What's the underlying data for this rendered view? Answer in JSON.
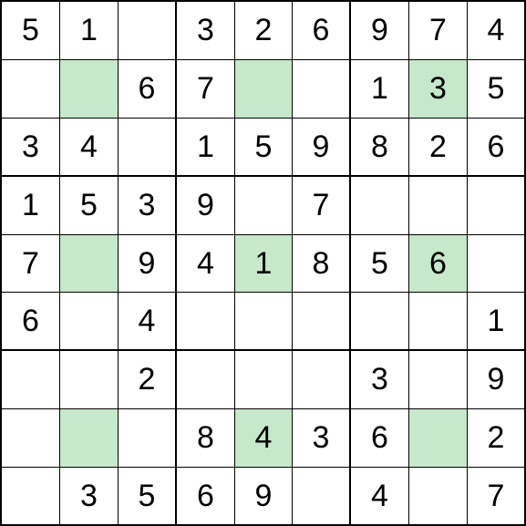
{
  "sudoku": {
    "size": 9,
    "cells": [
      [
        "5",
        "1",
        "",
        "3",
        "2",
        "6",
        "9",
        "7",
        "4"
      ],
      [
        "",
        "",
        "6",
        "7",
        "",
        "",
        "1",
        "3",
        "5"
      ],
      [
        "3",
        "4",
        "",
        "1",
        "5",
        "9",
        "8",
        "2",
        "6"
      ],
      [
        "1",
        "5",
        "3",
        "9",
        "",
        "7",
        "",
        "",
        ""
      ],
      [
        "7",
        "",
        "9",
        "4",
        "1",
        "8",
        "5",
        "6",
        ""
      ],
      [
        "6",
        "",
        "4",
        "",
        "",
        "",
        "",
        "",
        "1"
      ],
      [
        "",
        "",
        "2",
        "",
        "",
        "",
        "3",
        "",
        "9"
      ],
      [
        "",
        "",
        "",
        "8",
        "4",
        "3",
        "6",
        "",
        "2"
      ],
      [
        "",
        "3",
        "5",
        "6",
        "9",
        "",
        "4",
        "",
        "7"
      ]
    ],
    "highlights": [
      [
        1,
        1
      ],
      [
        1,
        4
      ],
      [
        1,
        7
      ],
      [
        4,
        1
      ],
      [
        4,
        4
      ],
      [
        4,
        7
      ],
      [
        7,
        1
      ],
      [
        7,
        4
      ],
      [
        7,
        7
      ]
    ]
  }
}
